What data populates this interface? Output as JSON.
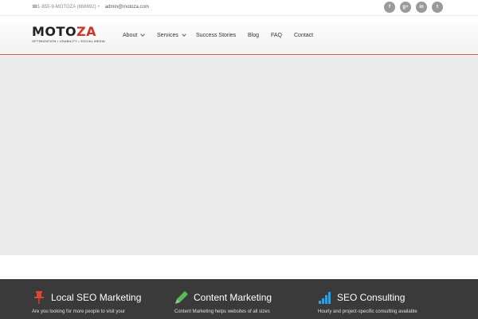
{
  "topbar": {
    "phone": "1-855-9-MOTOZA (668692)",
    "email": "admin@motoza.com",
    "social": [
      {
        "icon": "facebook-icon",
        "glyph": "f"
      },
      {
        "icon": "google-plus-icon",
        "glyph": "g+"
      },
      {
        "icon": "linkedin-icon",
        "glyph": "in"
      },
      {
        "icon": "twitter-icon",
        "glyph": "t"
      }
    ]
  },
  "header": {
    "logo": {
      "text_main": "MOTO",
      "text_accent": "ZA",
      "tagline": "OPTIMIZATION • USABILITY • SOCIAL MEDIA"
    },
    "nav": [
      {
        "label": "About",
        "dropdown": true
      },
      {
        "label": "Services",
        "dropdown": true
      },
      {
        "label": "Success Stories",
        "dropdown": false
      },
      {
        "label": "Blog",
        "dropdown": false
      },
      {
        "label": "FAQ",
        "dropdown": false
      },
      {
        "label": "Contact",
        "dropdown": false
      }
    ]
  },
  "features": [
    {
      "title": "Local SEO Marketing",
      "desc": "Are you looking for more people to visit your",
      "icon": "pushpin-icon",
      "icon_color": "#e0452f"
    },
    {
      "title": "Content Marketing",
      "desc": "Content Marketing helps websites of all sizes",
      "icon": "pencil-icon",
      "icon_color": "#5cb85c"
    },
    {
      "title": "SEO Consulting",
      "desc": "Hourly and project-specific consulting available",
      "icon": "bar-chart-icon",
      "icon_color": "#3a9bd9"
    }
  ],
  "colors": {
    "accent": "#d0342c",
    "banner": "#ebebeb",
    "features_bg": "#3a3a3a"
  }
}
